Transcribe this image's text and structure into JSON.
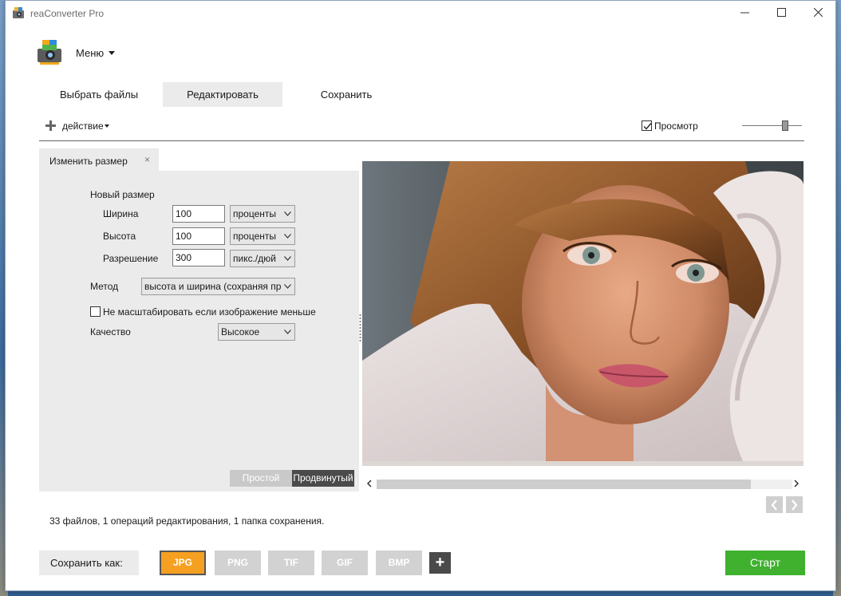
{
  "window": {
    "title": "reaConverter Pro"
  },
  "menu": {
    "label": "Меню"
  },
  "tabs": [
    {
      "label": "Выбрать файлы",
      "active": false
    },
    {
      "label": "Редактировать",
      "active": true
    },
    {
      "label": "Сохранить",
      "active": false
    }
  ],
  "toolbar": {
    "action_label": "действие",
    "preview_label": "Просмотр",
    "preview_checked": true
  },
  "panel": {
    "tab_title": "Изменить размер",
    "tab_close": "×",
    "section_title": "Новый размер",
    "width_label": "Ширина",
    "width_value": "100",
    "width_unit": "проценты",
    "height_label": "Высота",
    "height_value": "100",
    "height_unit": "проценты",
    "resolution_label": "Разрешение",
    "resolution_value": "300",
    "resolution_unit": "пикс./дюй",
    "method_label": "Метод",
    "method_value": "высота и ширина (сохраняя пр",
    "no_upscale_label": "Не масштабировать если изображение меньше",
    "no_upscale_checked": false,
    "quality_label": "Качество",
    "quality_value": "Высокое",
    "mode_simple": "Простой",
    "mode_advanced": "Продвинутый",
    "mode_active": "advanced"
  },
  "status": "33 файлов, 1 операций редактирования, 1 папка сохранения.",
  "bottom": {
    "save_as_label": "Сохранить как:",
    "formats": [
      "JPG",
      "PNG",
      "TIF",
      "GIF",
      "BMP"
    ],
    "active_format": "JPG",
    "add_label": "+",
    "start_label": "Старт"
  },
  "colors": {
    "accent_orange": "#f5a020",
    "start_green": "#3fb12f",
    "panel_gray": "#ebebeb"
  },
  "icons": [
    "app-icon",
    "window-minimize-icon",
    "window-maximize-icon",
    "window-close-icon",
    "app-logo-icon",
    "plus-icon",
    "chevron-down-icon",
    "chevron-left-icon",
    "chevron-right-icon",
    "checkmark-icon"
  ]
}
